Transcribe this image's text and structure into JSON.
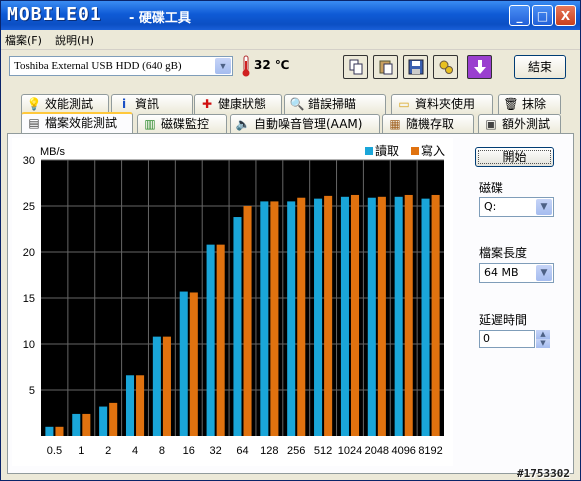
{
  "window": {
    "logo_text": "MOBILE01",
    "title": "- 硬碟工具",
    "buttons": {
      "minimize": "_",
      "maximize": "□",
      "close": "X"
    }
  },
  "menu": [
    "檔案(F)",
    "說明(H)"
  ],
  "toolbar": {
    "device": "Toshiba External USB HDD (640 gB)",
    "temperature": "32 ℃",
    "exit_label": "結束",
    "icons": [
      "copy-icon",
      "paste-icon",
      "save-icon",
      "options-icon",
      "download-icon"
    ]
  },
  "tabs_row1": [
    {
      "label": "效能測試",
      "icon": "lightbulb-icon"
    },
    {
      "label": "資訊",
      "icon": "info-icon"
    },
    {
      "label": "健康狀態",
      "icon": "health-cross-icon"
    },
    {
      "label": "錯誤掃瞄",
      "icon": "magnifier-icon"
    },
    {
      "label": "資料夾使用",
      "icon": "folder-icon"
    },
    {
      "label": "抹除",
      "icon": "trash-icon"
    }
  ],
  "tabs_row2": [
    {
      "label": "檔案效能測試",
      "icon": "file-benchmark-icon",
      "active": true
    },
    {
      "label": "磁碟監控",
      "icon": "monitor-chart-icon"
    },
    {
      "label": "自動噪音管理(AAM)",
      "icon": "speaker-icon"
    },
    {
      "label": "隨機存取",
      "icon": "random-access-icon"
    },
    {
      "label": "額外測試",
      "icon": "extra-test-icon"
    }
  ],
  "side": {
    "start_label": "開始",
    "drive_label": "磁碟",
    "drive_value": "Q:",
    "length_label": "檔案長度",
    "length_value": "64 MB",
    "delay_label": "延遲時間",
    "delay_value": "0"
  },
  "watermark": "#1753302",
  "colors": {
    "read": "#1aa6d9",
    "write": "#e0720f",
    "plot_bg": "#000000"
  },
  "chart_data": {
    "type": "bar",
    "ylabel": "MB/s",
    "ylim": [
      0,
      30
    ],
    "yticks": [
      5,
      10,
      15,
      20,
      25,
      30
    ],
    "categories": [
      "0.5",
      "1",
      "2",
      "4",
      "8",
      "16",
      "32",
      "64",
      "128",
      "256",
      "512",
      "1024",
      "2048",
      "4096",
      "8192"
    ],
    "series": [
      {
        "name": "讀取",
        "values": [
          1.0,
          2.4,
          3.2,
          6.6,
          10.8,
          15.7,
          20.8,
          23.8,
          25.5,
          25.5,
          25.8,
          26.0,
          25.9,
          26.0,
          25.8
        ]
      },
      {
        "name": "寫入",
        "values": [
          1.0,
          2.4,
          3.6,
          6.6,
          10.8,
          15.6,
          20.8,
          25.0,
          25.5,
          25.9,
          26.1,
          26.2,
          26.0,
          26.2,
          26.2
        ]
      }
    ],
    "grid": true,
    "legend": "top-right"
  }
}
